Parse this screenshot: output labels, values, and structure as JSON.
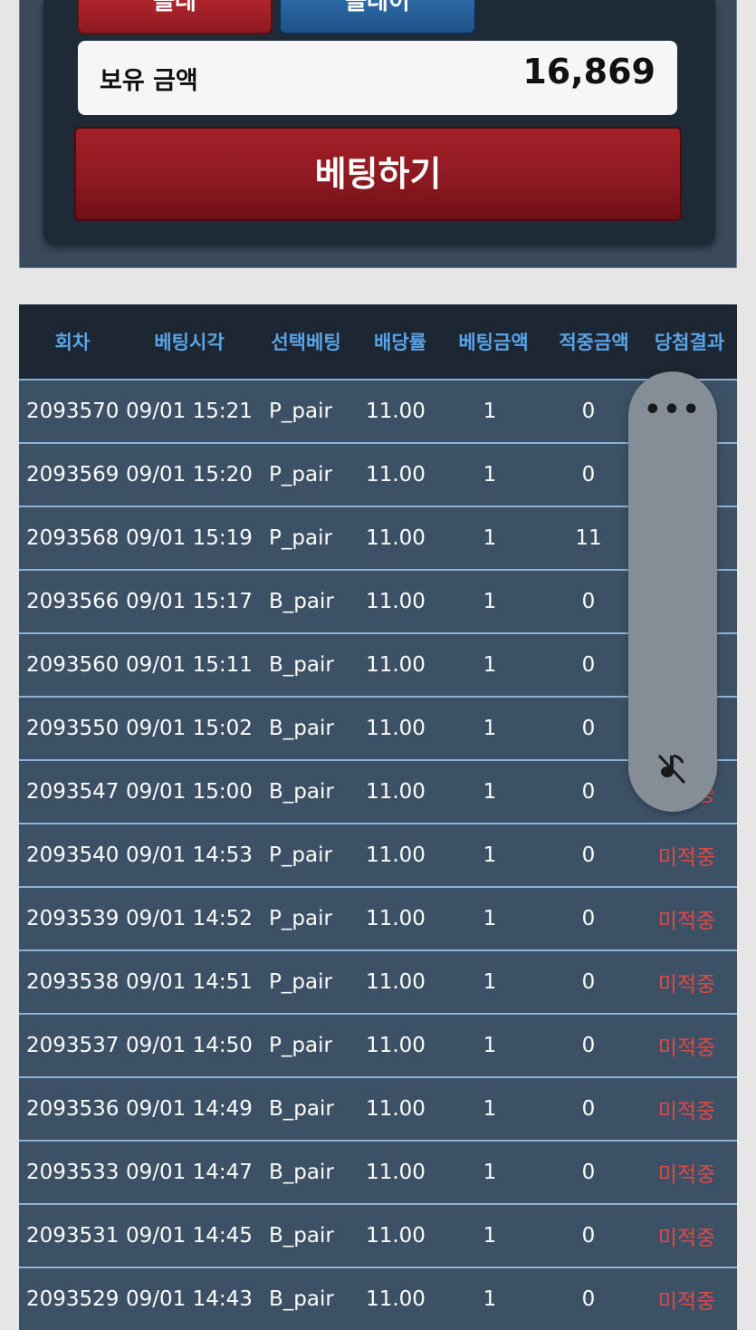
{
  "bet_panel": {
    "option_left_label": "플레",
    "option_right_label": "플레이",
    "balance_label": "보유 금액",
    "balance_value": "16,869",
    "bet_button_label": "베팅하기"
  },
  "colors": {
    "header_text": "#5aa3e6",
    "row_bg": "#3d5166",
    "lose_text": "#e04848",
    "bet_button": "#8b1820"
  },
  "history": {
    "columns": [
      "회차",
      "베팅시각",
      "선택베팅",
      "배당률",
      "베팅금액",
      "적중금액",
      "당첨결과"
    ],
    "rows": [
      {
        "round": "2093570",
        "time": "09/01 15:21",
        "pick": "P_pair",
        "odds": "11.00",
        "amount": "1",
        "win": "0",
        "result": ""
      },
      {
        "round": "2093569",
        "time": "09/01 15:20",
        "pick": "P_pair",
        "odds": "11.00",
        "amount": "1",
        "win": "0",
        "result": ""
      },
      {
        "round": "2093568",
        "time": "09/01 15:19",
        "pick": "P_pair",
        "odds": "11.00",
        "amount": "1",
        "win": "11",
        "result": ""
      },
      {
        "round": "2093566",
        "time": "09/01 15:17",
        "pick": "B_pair",
        "odds": "11.00",
        "amount": "1",
        "win": "0",
        "result": ""
      },
      {
        "round": "2093560",
        "time": "09/01 15:11",
        "pick": "B_pair",
        "odds": "11.00",
        "amount": "1",
        "win": "0",
        "result": ""
      },
      {
        "round": "2093550",
        "time": "09/01 15:02",
        "pick": "B_pair",
        "odds": "11.00",
        "amount": "1",
        "win": "0",
        "result": ""
      },
      {
        "round": "2093547",
        "time": "09/01 15:00",
        "pick": "B_pair",
        "odds": "11.00",
        "amount": "1",
        "win": "0",
        "result": "미적중"
      },
      {
        "round": "2093540",
        "time": "09/01 14:53",
        "pick": "P_pair",
        "odds": "11.00",
        "amount": "1",
        "win": "0",
        "result": "미적중"
      },
      {
        "round": "2093539",
        "time": "09/01 14:52",
        "pick": "P_pair",
        "odds": "11.00",
        "amount": "1",
        "win": "0",
        "result": "미적중"
      },
      {
        "round": "2093538",
        "time": "09/01 14:51",
        "pick": "P_pair",
        "odds": "11.00",
        "amount": "1",
        "win": "0",
        "result": "미적중"
      },
      {
        "round": "2093537",
        "time": "09/01 14:50",
        "pick": "P_pair",
        "odds": "11.00",
        "amount": "1",
        "win": "0",
        "result": "미적중"
      },
      {
        "round": "2093536",
        "time": "09/01 14:49",
        "pick": "B_pair",
        "odds": "11.00",
        "amount": "1",
        "win": "0",
        "result": "미적중"
      },
      {
        "round": "2093533",
        "time": "09/01 14:47",
        "pick": "B_pair",
        "odds": "11.00",
        "amount": "1",
        "win": "0",
        "result": "미적중"
      },
      {
        "round": "2093531",
        "time": "09/01 14:45",
        "pick": "B_pair",
        "odds": "11.00",
        "amount": "1",
        "win": "0",
        "result": "미적중"
      },
      {
        "round": "2093529",
        "time": "09/01 14:43",
        "pick": "B_pair",
        "odds": "11.00",
        "amount": "1",
        "win": "0",
        "result": "미적중"
      }
    ]
  },
  "overlay": {
    "more_icon": "more-horizontal-icon",
    "mute_icon": "notification-off-icon",
    "more_glyph": "•••"
  }
}
